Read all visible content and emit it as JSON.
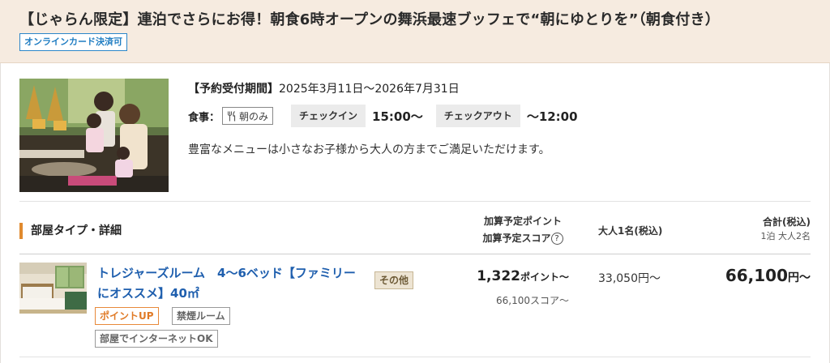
{
  "plan": {
    "title": "【じゃらん限定】連泊でさらにお得！朝食6時オープンの舞浜最速ブッフェで“朝にゆとりを”（朝食付き）",
    "card_badge": "オンラインカード決済可",
    "period_label": "【予約受付期間】",
    "period_value": "2025年3月11日～2026年7月31日",
    "meal_label": "食事：",
    "meal_value": "朝のみ",
    "checkin_label": "チェックイン",
    "checkin_time": "15:00～",
    "checkout_label": "チェックアウト",
    "checkout_time": "～12:00",
    "description": "豊富なメニューは小さなお子様から大人の方までご満足いただけます。"
  },
  "table": {
    "room_header": "部屋タイプ・詳細",
    "points_header_line1": "加算予定ポイント",
    "points_header_line2": "加算予定スコア",
    "help_glyph": "?",
    "adult_header": "大人1名(税込)",
    "total_header": "合計(税込)",
    "total_subheader": "1泊 大人2名"
  },
  "room": {
    "name": "トレジャーズルーム　4～6ベッド【ファミリーにオススメ】40㎡",
    "other_tag": "その他",
    "tags": [
      "ポイントUP",
      "禁煙ルーム",
      "部屋でインターネットOK"
    ],
    "points_value": "1,322",
    "points_unit": "ポイント～",
    "score_text": "66,100スコア～",
    "adult_price": "33,050円～",
    "total_value": "66,100",
    "total_unit": "円～"
  },
  "colors": {
    "accent": "#e08a2e",
    "link": "#1f5fae",
    "badge_blue": "#1f7dc2",
    "header_bg": "#f6ebe0"
  },
  "icons": {
    "meal": "fork-knife-icon",
    "help": "question-circle-icon"
  }
}
